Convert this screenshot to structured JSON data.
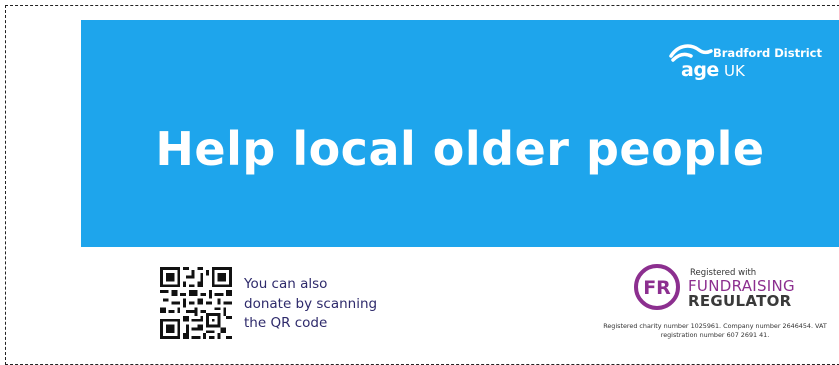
{
  "banner": {
    "headline": "Help local older people",
    "background_color": "#1ea5ec"
  },
  "logo": {
    "district": "Bradford District",
    "age": "age",
    "uk": "UK"
  },
  "qr": {
    "line1": "You can also",
    "line2": "donate by scanning",
    "line3": "the QR code"
  },
  "regulator": {
    "badge": "FR",
    "registered": "Registered with",
    "fundraising": "FUNDRAISING",
    "regulator": "REGULATOR"
  },
  "charity": {
    "line1": "Registered charity number 1025961. Company number 2646454. VAT",
    "line2": "registration number 607 2691 41."
  }
}
